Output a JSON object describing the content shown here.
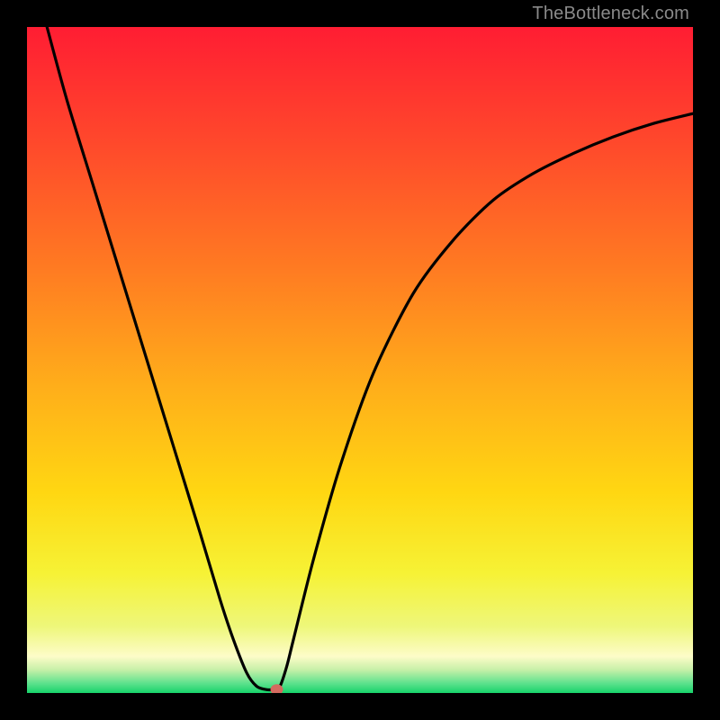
{
  "watermark": "TheBottleneck.com",
  "chart_data": {
    "type": "line",
    "title": "",
    "xlabel": "",
    "ylabel": "",
    "xlim": [
      0,
      100
    ],
    "ylim": [
      0,
      100
    ],
    "grid": false,
    "legend": false,
    "series": [
      {
        "name": "curve",
        "x": [
          3,
          6,
          10,
          14,
          18,
          22,
          26,
          29,
          31,
          33,
          34.5,
          36,
          37,
          37.5,
          38,
          39,
          40,
          43,
          47,
          52,
          58,
          64,
          70,
          76,
          82,
          88,
          94,
          100
        ],
        "y": [
          100,
          89,
          76,
          63,
          50,
          37,
          24,
          14,
          8,
          3,
          1,
          0.5,
          0.5,
          0.5,
          1,
          4,
          8,
          20,
          34,
          48,
          60,
          68,
          74,
          78,
          81,
          83.5,
          85.5,
          87
        ]
      }
    ],
    "marker": {
      "x": 37.5,
      "y": 0.5,
      "color": "#d46a5f"
    },
    "background_gradient": {
      "stops": [
        {
          "offset": 0.0,
          "color": "#ff1d33"
        },
        {
          "offset": 0.18,
          "color": "#ff4a2b"
        },
        {
          "offset": 0.36,
          "color": "#ff7a22"
        },
        {
          "offset": 0.54,
          "color": "#ffae1a"
        },
        {
          "offset": 0.7,
          "color": "#ffd712"
        },
        {
          "offset": 0.82,
          "color": "#f6f235"
        },
        {
          "offset": 0.9,
          "color": "#eef77a"
        },
        {
          "offset": 0.945,
          "color": "#fdfcc8"
        },
        {
          "offset": 0.965,
          "color": "#c7f0a8"
        },
        {
          "offset": 0.985,
          "color": "#5fe28e"
        },
        {
          "offset": 1.0,
          "color": "#17d36a"
        }
      ]
    }
  }
}
